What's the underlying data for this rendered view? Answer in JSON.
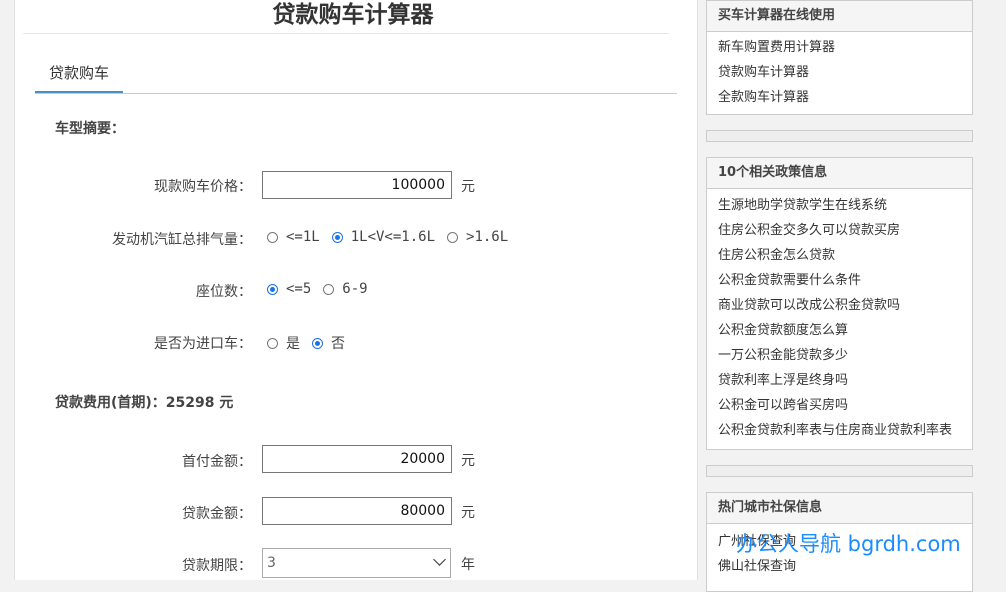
{
  "page_title": "贷款购车计算器",
  "tab": "贷款购车",
  "summary_heading": "车型摘要：",
  "price": {
    "label": "现款购车价格：",
    "value": "100000",
    "unit": "元"
  },
  "displacement": {
    "label": "发动机汽缸总排气量：",
    "options": [
      "<=1L",
      "1L<V<=1.6L",
      ">1.6L"
    ],
    "selected_index": 1
  },
  "seats": {
    "label": "座位数：",
    "options": [
      "<=5",
      "6-9"
    ],
    "selected_index": 0
  },
  "imported": {
    "label": "是否为进口车：",
    "options": [
      "是",
      "否"
    ],
    "selected_index": 1
  },
  "loan_cost": {
    "text": "贷款费用(首期)：25298 元"
  },
  "down_payment": {
    "label": "首付金额：",
    "value": "20000",
    "unit": "元"
  },
  "loan_amount": {
    "label": "贷款金额：",
    "value": "80000",
    "unit": "元"
  },
  "loan_term": {
    "label": "贷款期限：",
    "value": "3",
    "unit": "年"
  },
  "sidebar": {
    "box1": {
      "title": "买车计算器在线使用",
      "items": [
        "新车购置费用计算器",
        "贷款购车计算器",
        "全款购车计算器"
      ]
    },
    "box2": {
      "title": "10个相关政策信息",
      "items": [
        "生源地助学贷款学生在线系统",
        "住房公积金交多久可以贷款买房",
        "住房公积金怎么贷款",
        "公积金贷款需要什么条件",
        "商业贷款可以改成公积金贷款吗",
        "公积金贷款额度怎么算",
        "一万公积金能贷款多少",
        "贷款利率上浮是终身吗",
        "公积金可以跨省买房吗",
        "公积金贷款利率表与住房商业贷款利率表"
      ]
    },
    "box3": {
      "title": "热门城市社保信息",
      "items": [
        "广州社保查询",
        "佛山社保查询"
      ]
    }
  },
  "watermark": "办公人导航 bgrdh.com",
  "colors": {
    "accent": "#1a73e8",
    "tab_underline": "#4a8fc3",
    "watermark": "#1a8cff"
  }
}
